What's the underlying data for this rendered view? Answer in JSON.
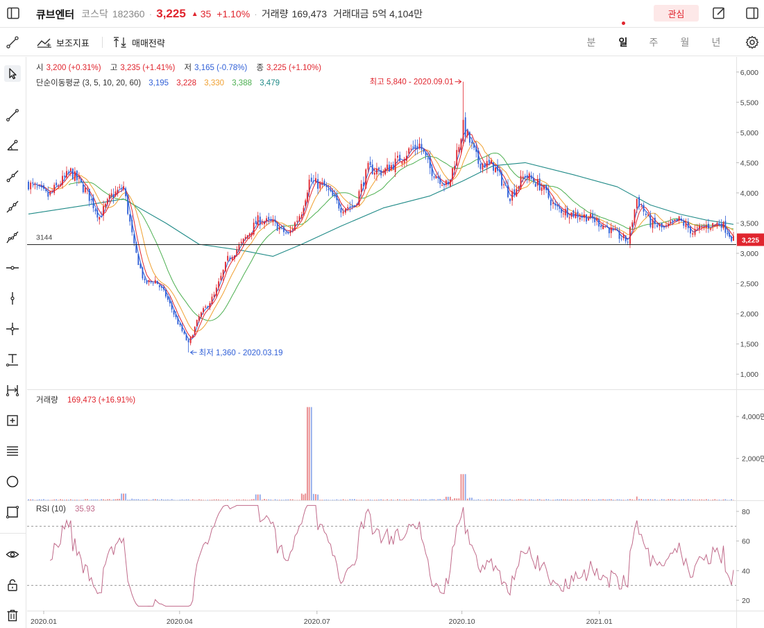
{
  "header": {
    "name": "큐브엔터",
    "market": "코스닥",
    "code": "182360",
    "price": "3,225",
    "change_arrow": "▲",
    "change": "35",
    "change_pct": "+1.10%",
    "volume_label": "거래량",
    "volume": "169,473",
    "amount_label": "거래대금",
    "amount": "5억 4,104만",
    "watch_label": "관심"
  },
  "toolbar": {
    "indicators_label": "보조지표",
    "strategy_label": "매매전략",
    "periods": [
      "분",
      "일",
      "주",
      "월",
      "년"
    ],
    "active_period": "일"
  },
  "rail": {
    "tools": [
      "cursor-icon",
      "trend-line-icon",
      "angle-line-icon",
      "ray-line-icon",
      "extended-line-icon",
      "polyline-icon",
      "horizontal-line-icon",
      "vertical-line-icon",
      "crosshair-icon",
      "text-icon",
      "measure-icon",
      "add-shape-icon",
      "fib-lines-icon",
      "circle-icon",
      "rectangle-icon",
      "eye-icon",
      "lock-icon",
      "trash-icon"
    ]
  },
  "legend": {
    "open_label": "시",
    "open": "3,200 (+0.31%)",
    "high_label": "고",
    "high": "3,235 (+1.41%)",
    "low_label": "저",
    "low": "3,165 (-0.78%)",
    "close_label": "종",
    "close": "3,225 (+1.10%)",
    "ma_label": "단순이동평균 (3, 5, 10, 20, 60)",
    "ma_values": [
      "3,195",
      "3,228",
      "3,330",
      "3,388",
      "3,479"
    ]
  },
  "colors": {
    "up": "#e0252e",
    "down": "#2f5fd7",
    "ma3": "#2f5fd7",
    "ma5": "#e0252e",
    "ma10": "#f0a030",
    "ma20": "#4caf50",
    "ma60": "#1f8a87",
    "rsi": "#c06a8a"
  },
  "chart_data": [
    {
      "type": "candlestick",
      "name": "price",
      "x_ticks": [
        "2020.01",
        "2020.04",
        "2020.07",
        "2020.10",
        "2021.01"
      ],
      "y_ticks": [
        "6,000",
        "5,500",
        "5,000",
        "4,500",
        "4,000",
        "3,500",
        "3,000",
        "2,500",
        "2,000",
        "1,500",
        "1,000"
      ],
      "ylim": [
        750,
        6250
      ],
      "h_line": {
        "value": 3144,
        "label": "3144"
      },
      "last_price_tag": "3,225",
      "high_annotation": {
        "text": "최고 5,840 - 2020.09.01",
        "value": 5840,
        "date": "2020.09.01"
      },
      "low_annotation": {
        "text": "최저 1,360 - 2020.03.19",
        "value": 1360,
        "date": "2020.03.19"
      },
      "close_anchors": [
        {
          "date": "2020.01.02",
          "close": 4150
        },
        {
          "date": "2020.01.15",
          "close": 3950
        },
        {
          "date": "2020.01.30",
          "close": 4350
        },
        {
          "date": "2020.02.10",
          "close": 4000
        },
        {
          "date": "2020.02.18",
          "close": 3600
        },
        {
          "date": "2020.02.26",
          "close": 3950
        },
        {
          "date": "2020.03.05",
          "close": 4100
        },
        {
          "date": "2020.03.12",
          "close": 3100
        },
        {
          "date": "2020.03.19",
          "close": 2500
        },
        {
          "date": "2020.03.26",
          "close": 2550
        },
        {
          "date": "2020.04.02",
          "close": 2300
        },
        {
          "date": "2020.04.10",
          "close": 1850
        },
        {
          "date": "2020.04.17",
          "close": 1500
        },
        {
          "date": "2020.04.24",
          "close": 1950
        },
        {
          "date": "2020.05.04",
          "close": 2300
        },
        {
          "date": "2020.05.13",
          "close": 2900
        },
        {
          "date": "2020.05.22",
          "close": 3150
        },
        {
          "date": "2020.06.02",
          "close": 3550
        },
        {
          "date": "2020.06.12",
          "close": 3500
        },
        {
          "date": "2020.06.22",
          "close": 3300
        },
        {
          "date": "2020.07.01",
          "close": 3700
        },
        {
          "date": "2020.07.06",
          "close": 4200
        },
        {
          "date": "2020.07.16",
          "close": 4100
        },
        {
          "date": "2020.07.27",
          "close": 3750
        },
        {
          "date": "2020.08.05",
          "close": 3800
        },
        {
          "date": "2020.08.14",
          "close": 4400
        },
        {
          "date": "2020.08.24",
          "close": 4350
        },
        {
          "date": "2020.09.01",
          "close": 4500
        },
        {
          "date": "2020.09.10",
          "close": 4700
        },
        {
          "date": "2020.09.17",
          "close": 4800
        },
        {
          "date": "2020.09.24",
          "close": 4400
        },
        {
          "date": "2020.10.06",
          "close": 4100
        },
        {
          "date": "2020.10.16",
          "close": 5100
        },
        {
          "date": "2020.10.26",
          "close": 4500
        },
        {
          "date": "2020.11.05",
          "close": 4450
        },
        {
          "date": "2020.11.16",
          "close": 3950
        },
        {
          "date": "2020.11.26",
          "close": 4300
        },
        {
          "date": "2020.12.07",
          "close": 4100
        },
        {
          "date": "2020.12.16",
          "close": 3750
        },
        {
          "date": "2020.12.28",
          "close": 3650
        },
        {
          "date": "2021.01.07",
          "close": 3600
        },
        {
          "date": "2021.01.18",
          "close": 3450
        },
        {
          "date": "2021.01.26",
          "close": 3300
        },
        {
          "date": "2021.02.02",
          "close": 3200
        },
        {
          "date": "2021.02.08",
          "close": 3900
        },
        {
          "date": "2021.02.17",
          "close": 3500
        },
        {
          "date": "2021.02.26",
          "close": 3400
        },
        {
          "date": "2021.03.08",
          "close": 3550
        },
        {
          "date": "2021.03.17",
          "close": 3350
        },
        {
          "date": "2021.03.26",
          "close": 3450
        },
        {
          "date": "2021.04.05",
          "close": 3500
        },
        {
          "date": "2021.04.13",
          "close": 3225
        }
      ],
      "ma60_anchors": [
        {
          "date": "2020.01.02",
          "value": 3650
        },
        {
          "date": "2020.02.10",
          "value": 3800
        },
        {
          "date": "2020.03.05",
          "value": 3900
        },
        {
          "date": "2020.04.02",
          "value": 3500
        },
        {
          "date": "2020.04.24",
          "value": 3150
        },
        {
          "date": "2020.05.22",
          "value": 3050
        },
        {
          "date": "2020.06.12",
          "value": 2950
        },
        {
          "date": "2020.07.01",
          "value": 3150
        },
        {
          "date": "2020.07.27",
          "value": 3450
        },
        {
          "date": "2020.08.24",
          "value": 3750
        },
        {
          "date": "2020.09.24",
          "value": 3950
        },
        {
          "date": "2020.10.16",
          "value": 4200
        },
        {
          "date": "2020.11.05",
          "value": 4450
        },
        {
          "date": "2020.11.26",
          "value": 4500
        },
        {
          "date": "2020.12.28",
          "value": 4300
        },
        {
          "date": "2021.01.26",
          "value": 4100
        },
        {
          "date": "2021.02.17",
          "value": 3800
        },
        {
          "date": "2021.03.08",
          "value": 3650
        },
        {
          "date": "2021.03.26",
          "value": 3550
        },
        {
          "date": "2021.04.13",
          "value": 3479
        }
      ]
    },
    {
      "type": "bar",
      "name": "volume",
      "label": "거래량",
      "value_text": "169,473 (+16.91%)",
      "y_ticks": [
        "4,000만",
        "2,000만"
      ],
      "ylim_man": [
        0,
        5000
      ],
      "spikes": [
        {
          "date": "2020.03.05",
          "value_man": 320
        },
        {
          "date": "2020.06.02",
          "value_man": 280
        },
        {
          "date": "2020.07.06",
          "value_man": 4450
        },
        {
          "date": "2020.10.06",
          "value_man": 170
        },
        {
          "date": "2020.10.16",
          "value_man": 1250
        },
        {
          "date": "2021.02.08",
          "value_man": 180
        }
      ]
    },
    {
      "type": "line",
      "name": "rsi",
      "label": "RSI (10)",
      "value_text": "35.93",
      "y_ticks": [
        "80",
        "60",
        "40",
        "20"
      ],
      "ylim": [
        13,
        87
      ],
      "levels": [
        70,
        30
      ]
    }
  ]
}
